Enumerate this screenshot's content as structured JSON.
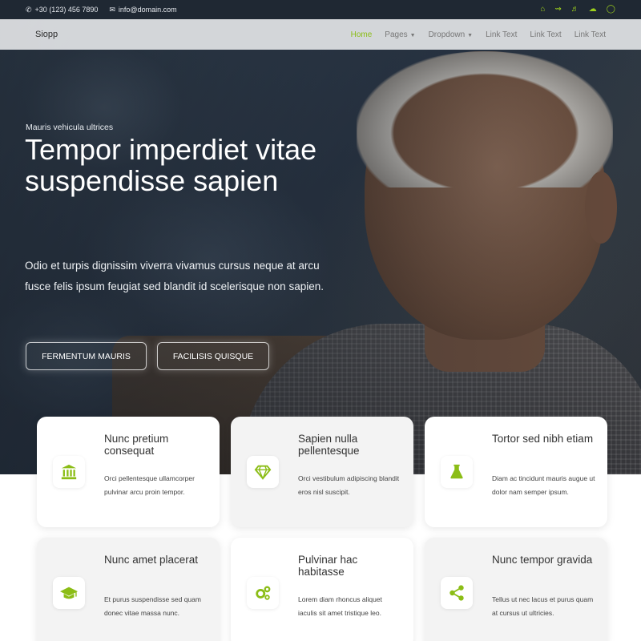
{
  "topbar": {
    "phone": "+30 (123) 456 7890",
    "email": "info@domain.com",
    "social_icons": [
      "home-icon",
      "rss-icon",
      "volume-icon",
      "cloud-icon",
      "chat-icon"
    ]
  },
  "navbar": {
    "brand": "Siopp",
    "items": [
      {
        "label": "Home",
        "active": true
      },
      {
        "label": "Pages",
        "dropdown": true
      },
      {
        "label": "Dropdown",
        "dropdown": true
      },
      {
        "label": "Link Text"
      },
      {
        "label": "Link Text"
      },
      {
        "label": "Link Text"
      }
    ]
  },
  "hero": {
    "kicker": "Mauris vehicula ultrices",
    "headline": "Tempor imperdiet vitae suspendisse sapien",
    "lede": "Odio et turpis dignissim viverra vivamus cursus neque at arcu fusce felis ipsum feugiat sed blandit id scelerisque non sapien.",
    "buttons": [
      "FERMENTUM MAURIS",
      "FACILISIS QUISQUE"
    ]
  },
  "features": [
    {
      "title": "Nunc pretium consequat",
      "desc": "Orci pellentesque ullamcorper pulvinar arcu proin tempor.",
      "icon": "bank-icon"
    },
    {
      "title": "Sapien nulla pellentesque",
      "desc": "Orci vestibulum adipiscing blandit eros nisl suscipit.",
      "icon": "diamond-icon"
    },
    {
      "title": "Tortor sed nibh etiam",
      "desc": "Diam ac tincidunt mauris augue ut dolor nam semper ipsum.",
      "icon": "flask-icon"
    },
    {
      "title": "Nunc amet placerat",
      "desc": "Et purus suspendisse sed quam donec vitae massa nunc.",
      "icon": "graduation-cap-icon"
    },
    {
      "title": "Pulvinar hac habitasse",
      "desc": "Lorem diam rhoncus aliquet iaculis sit amet tristique leo.",
      "icon": "cogs-icon"
    },
    {
      "title": "Nunc tempor gravida",
      "desc": "Tellus ut nec lacus et purus quam at cursus ut ultricies.",
      "icon": "share-icon"
    }
  ],
  "colors": {
    "accent": "#8bbd16",
    "topbar_bg": "#1f2833"
  }
}
